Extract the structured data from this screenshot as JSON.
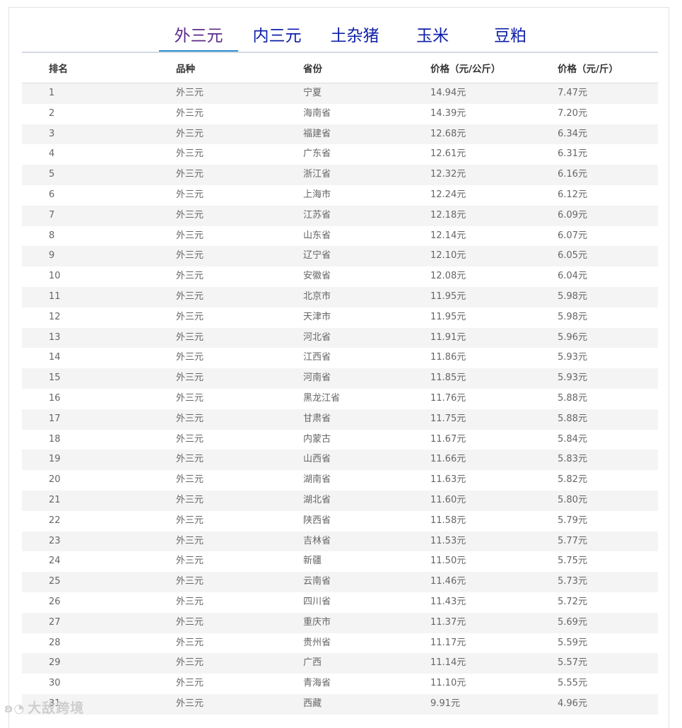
{
  "tabs": [
    "外三元",
    "内三元",
    "土杂猪",
    "玉米",
    "豆粕"
  ],
  "active_tab": 0,
  "table": {
    "headers": [
      "排名",
      "品种",
      "省份",
      "价格（元/公斤）",
      "价格（元/斤）"
    ],
    "rows": [
      [
        "1",
        "外三元",
        "宁夏",
        "14.94元",
        "7.47元"
      ],
      [
        "2",
        "外三元",
        "海南省",
        "14.39元",
        "7.20元"
      ],
      [
        "3",
        "外三元",
        "福建省",
        "12.68元",
        "6.34元"
      ],
      [
        "4",
        "外三元",
        "广东省",
        "12.61元",
        "6.31元"
      ],
      [
        "5",
        "外三元",
        "浙江省",
        "12.32元",
        "6.16元"
      ],
      [
        "6",
        "外三元",
        "上海市",
        "12.24元",
        "6.12元"
      ],
      [
        "7",
        "外三元",
        "江苏省",
        "12.18元",
        "6.09元"
      ],
      [
        "8",
        "外三元",
        "山东省",
        "12.14元",
        "6.07元"
      ],
      [
        "9",
        "外三元",
        "辽宁省",
        "12.10元",
        "6.05元"
      ],
      [
        "10",
        "外三元",
        "安徽省",
        "12.08元",
        "6.04元"
      ],
      [
        "11",
        "外三元",
        "北京市",
        "11.95元",
        "5.98元"
      ],
      [
        "12",
        "外三元",
        "天津市",
        "11.95元",
        "5.98元"
      ],
      [
        "13",
        "外三元",
        "河北省",
        "11.91元",
        "5.96元"
      ],
      [
        "14",
        "外三元",
        "江西省",
        "11.86元",
        "5.93元"
      ],
      [
        "15",
        "外三元",
        "河南省",
        "11.85元",
        "5.93元"
      ],
      [
        "16",
        "外三元",
        "黑龙江省",
        "11.76元",
        "5.88元"
      ],
      [
        "17",
        "外三元",
        "甘肃省",
        "11.75元",
        "5.88元"
      ],
      [
        "18",
        "外三元",
        "内蒙古",
        "11.67元",
        "5.84元"
      ],
      [
        "19",
        "外三元",
        "山西省",
        "11.66元",
        "5.83元"
      ],
      [
        "20",
        "外三元",
        "湖南省",
        "11.63元",
        "5.82元"
      ],
      [
        "21",
        "外三元",
        "湖北省",
        "11.60元",
        "5.80元"
      ],
      [
        "22",
        "外三元",
        "陕西省",
        "11.58元",
        "5.79元"
      ],
      [
        "23",
        "外三元",
        "吉林省",
        "11.53元",
        "5.77元"
      ],
      [
        "24",
        "外三元",
        "新疆",
        "11.50元",
        "5.75元"
      ],
      [
        "25",
        "外三元",
        "云南省",
        "11.46元",
        "5.73元"
      ],
      [
        "26",
        "外三元",
        "四川省",
        "11.43元",
        "5.72元"
      ],
      [
        "27",
        "外三元",
        "重庆市",
        "11.37元",
        "5.69元"
      ],
      [
        "28",
        "外三元",
        "贵州省",
        "11.17元",
        "5.59元"
      ],
      [
        "29",
        "外三元",
        "广西",
        "11.14元",
        "5.57元"
      ],
      [
        "30",
        "外三元",
        "青海省",
        "11.10元",
        "5.55元"
      ],
      [
        "31",
        "外三元",
        "西藏",
        "9.91元",
        "4.96元"
      ]
    ]
  },
  "watermark": {
    "text": "大敌跨境",
    "icon": "weibo-logo-icon"
  }
}
